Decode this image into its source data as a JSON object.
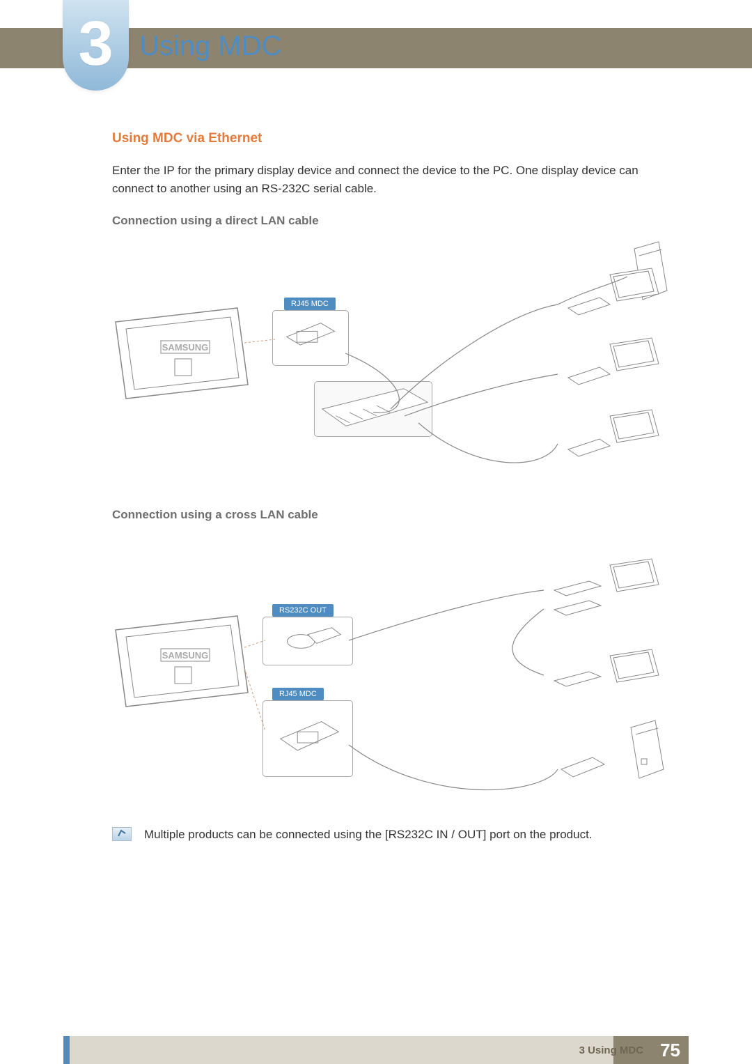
{
  "chapter": {
    "number": "3",
    "title": "Using MDC"
  },
  "section": {
    "heading": "Using MDC via Ethernet",
    "intro": "Enter the IP for the primary display device and connect the device to the PC. One display device can connect to another using an RS-232C serial cable.",
    "sub1": "Connection using a direct LAN cable",
    "sub2": "Connection using a cross LAN cable"
  },
  "diagram1": {
    "port_label": "RJ45 MDC",
    "brand": "SAMSUNG"
  },
  "diagram2": {
    "port_label_top": "RS232C OUT",
    "port_label_bottom": "RJ45 MDC",
    "brand": "SAMSUNG"
  },
  "note": {
    "text": "Multiple products can be connected using the [RS232C IN / OUT] port on the product."
  },
  "footer": {
    "label": "3 Using MDC",
    "page": "75"
  }
}
